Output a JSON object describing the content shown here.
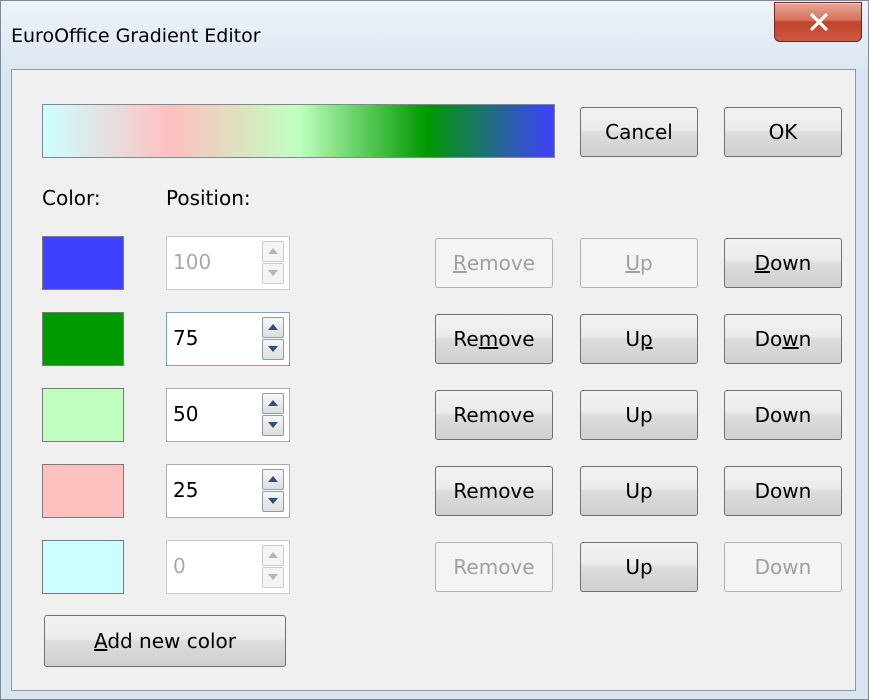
{
  "window": {
    "title": "EuroOffice Gradient Editor",
    "close_label": "X"
  },
  "gradient_preview": {
    "stops": [
      {
        "position": 0,
        "color": "#ccffff"
      },
      {
        "position": 25,
        "color": "#ffc0c0"
      },
      {
        "position": 50,
        "color": "#c0ffc0"
      },
      {
        "position": 75,
        "color": "#009900"
      },
      {
        "position": 100,
        "color": "#4040ff"
      }
    ]
  },
  "buttons": {
    "cancel_label": "Cancel",
    "ok_label": "OK",
    "add_new_color_label": "Add new color"
  },
  "headers": {
    "color_label": "Color:",
    "position_label": "Position:"
  },
  "rows": [
    {
      "color": "#4040ff",
      "position": "100",
      "position_enabled": false,
      "remove_label": "Remove",
      "up_label": "Up",
      "down_label": "Down",
      "remove_enabled": false,
      "up_enabled": false,
      "down_enabled": true
    },
    {
      "color": "#009900",
      "position": "75",
      "position_enabled": true,
      "remove_label": "Remove",
      "up_label": "Up",
      "down_label": "Down",
      "remove_enabled": true,
      "up_enabled": true,
      "down_enabled": true
    },
    {
      "color": "#c0ffc0",
      "position": "50",
      "position_enabled": true,
      "remove_label": "Remove",
      "up_label": "Up",
      "down_label": "Down",
      "remove_enabled": true,
      "up_enabled": true,
      "down_enabled": true
    },
    {
      "color": "#ffc0c0",
      "position": "25",
      "position_enabled": true,
      "remove_label": "Remove",
      "up_label": "Up",
      "down_label": "Down",
      "remove_enabled": true,
      "up_enabled": true,
      "down_enabled": true
    },
    {
      "color": "#ccffff",
      "position": "0",
      "position_enabled": false,
      "remove_label": "Remove",
      "up_label": "Up",
      "down_label": "Down",
      "remove_enabled": false,
      "up_enabled": true,
      "down_enabled": false
    }
  ]
}
